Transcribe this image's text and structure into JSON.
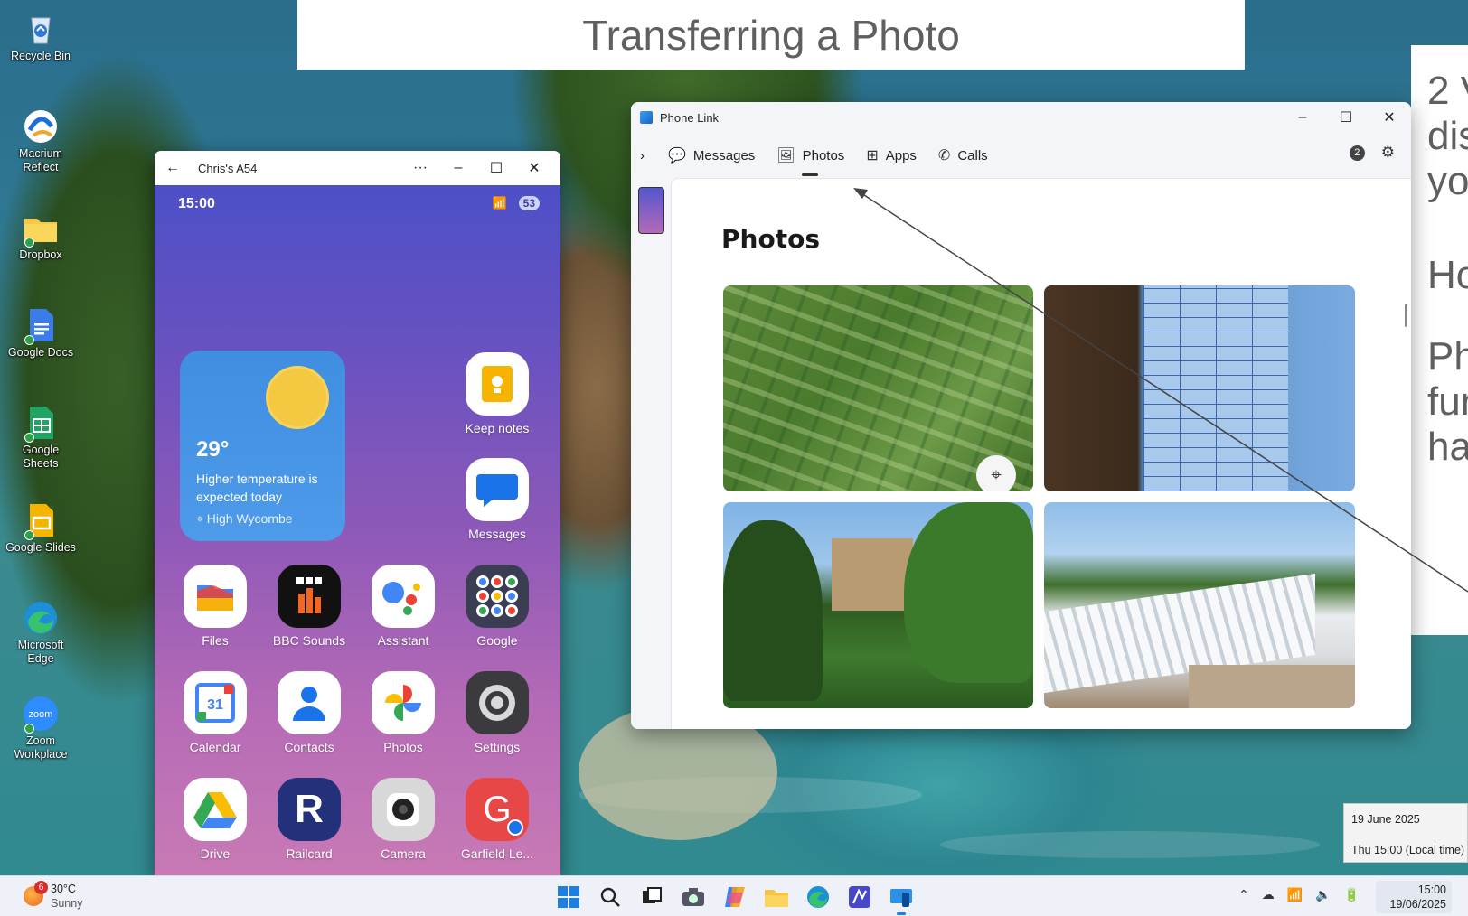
{
  "banner": {
    "title": "Transferring a Photo"
  },
  "side_panel": {
    "lines": [
      "2 V",
      "dis",
      "yo",
      "Ho",
      "Ph",
      "fur",
      "ha"
    ]
  },
  "desktop_icons": [
    {
      "label": "Recycle Bin",
      "icon": "recycle-bin-icon"
    },
    {
      "label": "Macrium Reflect",
      "icon": "macrium-reflect-icon"
    },
    {
      "label": "Dropbox",
      "icon": "folder-icon"
    },
    {
      "label": "Google Docs",
      "icon": "google-docs-icon"
    },
    {
      "label": "Google Sheets",
      "icon": "google-sheets-icon"
    },
    {
      "label": "Google Slides",
      "icon": "google-slides-icon"
    },
    {
      "label": "Microsoft Edge",
      "icon": "edge-icon"
    },
    {
      "label": "Zoom Workplace",
      "icon": "zoom-icon"
    }
  ],
  "phone_window": {
    "title": "Chris's A54",
    "status_time": "15:00",
    "battery": "53",
    "weather": {
      "temp": "29°",
      "desc": "Higher temperature is expected today",
      "location": "High Wycombe"
    },
    "apps": [
      {
        "label": "Keep notes",
        "icon": "keep-notes-icon"
      },
      {
        "label": "Messages",
        "icon": "messages-icon"
      },
      {
        "label": "Files",
        "icon": "files-icon"
      },
      {
        "label": "BBC Sounds",
        "icon": "bbc-sounds-icon"
      },
      {
        "label": "Assistant",
        "icon": "assistant-icon"
      },
      {
        "label": "Google",
        "icon": "google-folder-icon"
      },
      {
        "label": "Calendar",
        "icon": "calendar-icon",
        "badge": "31"
      },
      {
        "label": "Contacts",
        "icon": "contacts-icon"
      },
      {
        "label": "Photos",
        "icon": "photos-icon"
      },
      {
        "label": "Settings",
        "icon": "settings-icon"
      },
      {
        "label": "Drive",
        "icon": "drive-icon"
      },
      {
        "label": "Railcard",
        "icon": "railcard-icon",
        "glyph": "R"
      },
      {
        "label": "Camera",
        "icon": "camera-icon"
      },
      {
        "label": "Garfield Le...",
        "icon": "garfield-icon",
        "glyph": "G"
      }
    ]
  },
  "phone_link": {
    "title": "Phone Link",
    "tabs": [
      {
        "label": "Messages",
        "icon": "message-bubble-icon"
      },
      {
        "label": "Photos",
        "icon": "photo-icon",
        "active": true
      },
      {
        "label": "Apps",
        "icon": "apps-icon"
      },
      {
        "label": "Calls",
        "icon": "phone-icon"
      }
    ],
    "notification_count": "2",
    "heading": "Photos",
    "photos": [
      {
        "name": "aerial-allotments-photo"
      },
      {
        "name": "allotment-plot-board-photo"
      },
      {
        "name": "country-house-garden-photo"
      },
      {
        "name": "greenhouses-path-photo"
      }
    ]
  },
  "taskbar": {
    "weather_temp": "30°C",
    "weather_desc": "Sunny",
    "weather_badge": "6",
    "clock_time": "15:00",
    "clock_date": "19/06/2025"
  },
  "date_tooltip": {
    "date": "19 June 2025",
    "local": "Thu 15:00 (Local time)"
  },
  "colors": {
    "banner_text": "#5f5f5f",
    "phone_gradient_top": "#4d4fc7",
    "phone_gradient_bottom": "#c97ab5",
    "weather_widget": "#4e9aeb"
  }
}
